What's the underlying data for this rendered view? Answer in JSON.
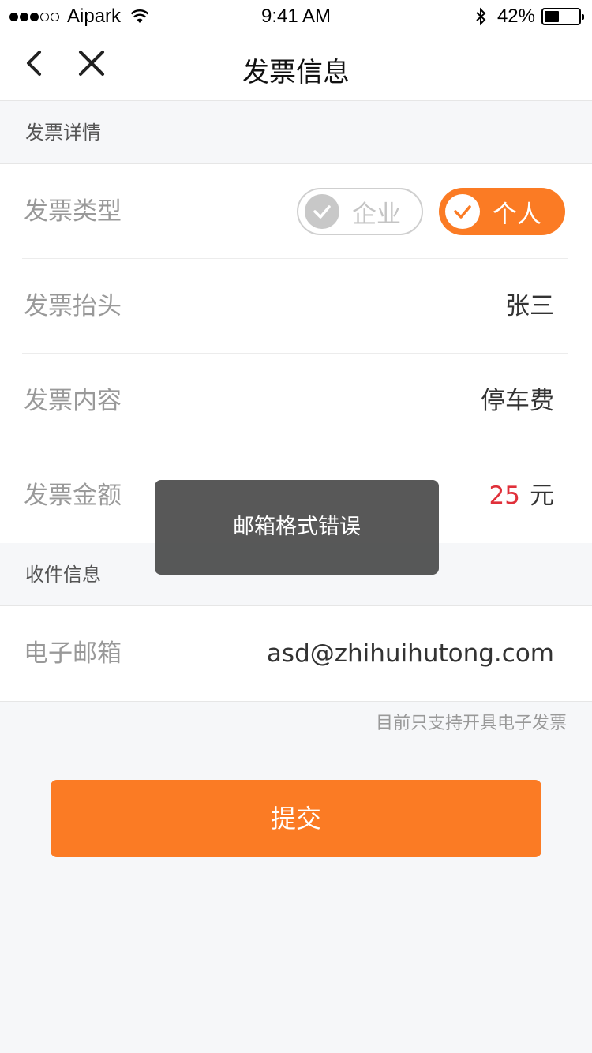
{
  "status_bar": {
    "carrier": "Aipark",
    "time": "9:41 AM",
    "battery": "42%",
    "battery_level": 0.42
  },
  "nav": {
    "title": "发票信息"
  },
  "invoice_section": {
    "header": "发票详情",
    "type_label": "发票类型",
    "type_options": [
      "企业",
      "个人"
    ],
    "type_selected": "个人",
    "title_label": "发票抬头",
    "title_value": "张三",
    "content_label": "发票内容",
    "content_value": "停车费",
    "amount_label": "发票金额",
    "amount_value": "25",
    "amount_unit": "元"
  },
  "delivery_section": {
    "header": "收件信息",
    "email_label": "电子邮箱",
    "email_value": "asd@zhihuihutong.com",
    "hint": "目前只支持开具电子发票"
  },
  "submit_label": "提交",
  "toast": "邮箱格式错误",
  "colors": {
    "accent": "#fb7b24",
    "amount": "#e0303a"
  }
}
